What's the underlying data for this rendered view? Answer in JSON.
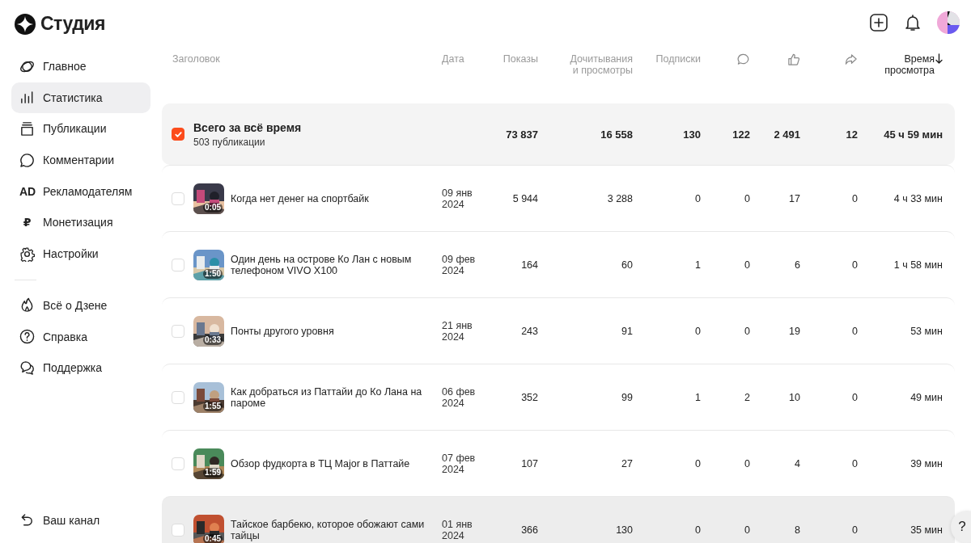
{
  "logo": {
    "text": "Студия"
  },
  "sidebar": {
    "items": [
      {
        "label": "Главное",
        "selected": false
      },
      {
        "label": "Статистика",
        "selected": true
      },
      {
        "label": "Публикации",
        "selected": false
      },
      {
        "label": "Комментарии",
        "selected": false
      },
      {
        "label": "Рекламодателям",
        "selected": false,
        "icon_text": "AD"
      },
      {
        "label": "Монетизация",
        "selected": false,
        "icon_text": "₽"
      },
      {
        "label": "Настройки",
        "selected": false
      }
    ],
    "secondary_items": [
      {
        "label": "Всё о Дзене"
      },
      {
        "label": "Справка"
      },
      {
        "label": "Поддержка"
      }
    ],
    "footer_item": {
      "label": "Ваш канал"
    }
  },
  "table": {
    "columns": [
      {
        "kind": "text",
        "label": "Заголовок",
        "sorted": false
      },
      {
        "kind": "text",
        "label": "Дата",
        "sorted": false
      },
      {
        "kind": "text",
        "label": "Показы",
        "sorted": false
      },
      {
        "kind": "text",
        "label": "Дочитывания и просмотры",
        "sorted": false
      },
      {
        "kind": "text",
        "label": "Подписки",
        "sorted": false
      },
      {
        "kind": "icon",
        "sorted": false
      },
      {
        "kind": "icon",
        "sorted": false
      },
      {
        "kind": "icon",
        "sorted": false
      },
      {
        "kind": "text",
        "label": "Время просмотра",
        "sorted": true
      }
    ],
    "total": {
      "title": "Всего за всё время",
      "subtitle": "503 публикации",
      "checked": true,
      "values": [
        "73 837",
        "16 558",
        "130",
        "122",
        "2 491",
        "12",
        "45 ч 59 мин"
      ]
    },
    "rows": [
      {
        "checked": false,
        "highlighted": false,
        "duration": "0:05",
        "title": "Когда нет денег на спортбайк",
        "date": "09 янв 2024",
        "values": [
          "5 944",
          "3 288",
          "0",
          "0",
          "17",
          "0",
          "4 ч 33 мин"
        ]
      },
      {
        "checked": false,
        "highlighted": false,
        "duration": "1:50",
        "title": "Один день на острове Ко Лан с новым телефоном VIVO X100",
        "date": "09 фев 2024",
        "values": [
          "164",
          "60",
          "1",
          "0",
          "6",
          "0",
          "1 ч 58 мин"
        ]
      },
      {
        "checked": false,
        "highlighted": false,
        "duration": "0:33",
        "title": "Понты другого уровня",
        "date": "21 янв 2024",
        "values": [
          "243",
          "91",
          "0",
          "0",
          "19",
          "0",
          "53 мин"
        ]
      },
      {
        "checked": false,
        "highlighted": false,
        "duration": "1:55",
        "title": "Как добраться из Паттайи до Ко Лана на пароме",
        "date": "06 фев 2024",
        "values": [
          "352",
          "99",
          "1",
          "2",
          "10",
          "0",
          "49 мин"
        ]
      },
      {
        "checked": false,
        "highlighted": false,
        "duration": "1:59",
        "title": "Обзор фудкорта в ТЦ Major в Паттайе",
        "date": "07 фев 2024",
        "values": [
          "107",
          "27",
          "0",
          "0",
          "4",
          "0",
          "39 мин"
        ]
      },
      {
        "checked": false,
        "highlighted": true,
        "duration": "0:45",
        "title": "Тайское барбекю, которое обожают сами тайцы",
        "date": "01 янв 2024",
        "values": [
          "366",
          "130",
          "0",
          "0",
          "8",
          "0",
          "35 мин"
        ]
      }
    ]
  },
  "help_button": {
    "label": "?"
  }
}
